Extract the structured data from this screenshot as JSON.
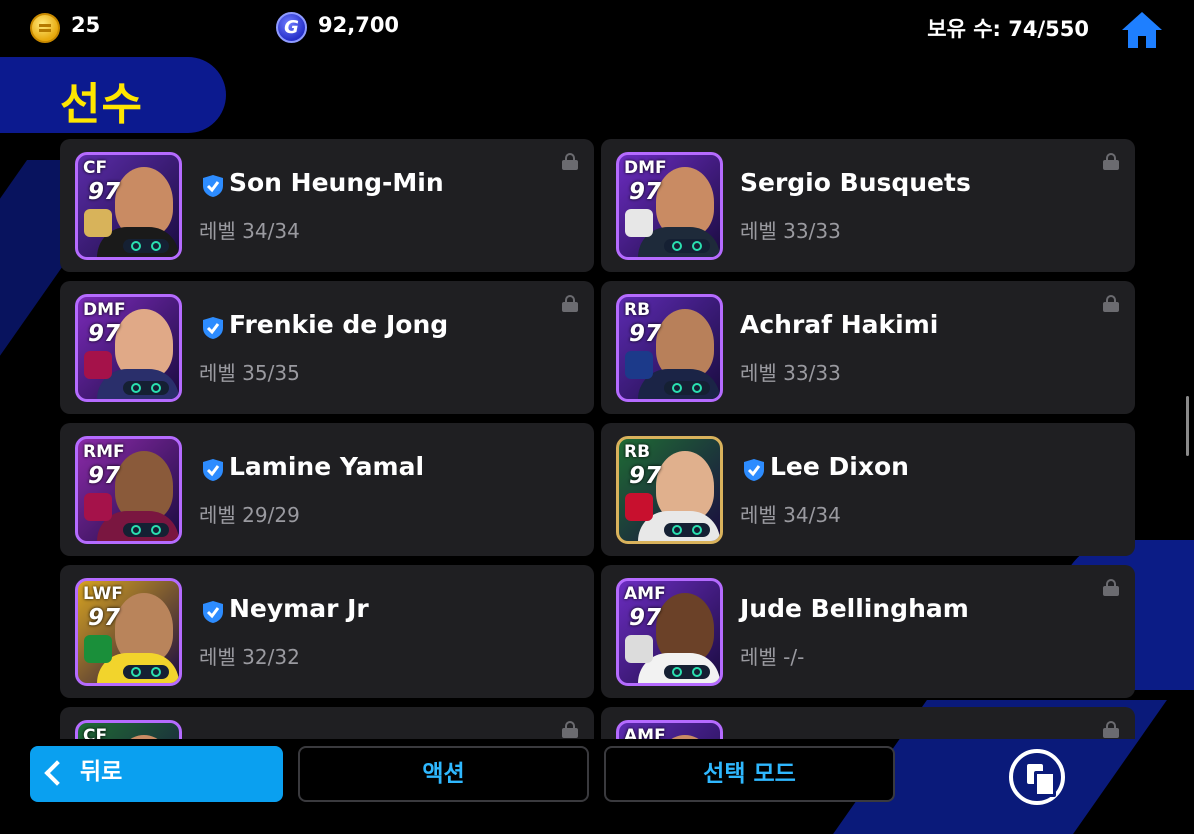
{
  "currency": {
    "coins": "25",
    "gp": "92,700",
    "gp_symbol": "G"
  },
  "owned": "보유 수: 74/550",
  "title": "선수",
  "players": [
    {
      "position": "CF",
      "rating": "97",
      "name": "Son Heung-Min",
      "level": "레벨 34/34",
      "verified": true,
      "locked": true,
      "colors": {
        "bg": "#5b2ca8",
        "skin": "#c98b63",
        "kit": "#1a1a1a",
        "badge": "#d8b35a"
      }
    },
    {
      "position": "DMF",
      "rating": "97",
      "name": "Sergio Busquets",
      "level": "레벨 33/33",
      "verified": false,
      "locked": true,
      "colors": {
        "bg": "#6b2cc0",
        "skin": "#c98b63",
        "kit": "#1e2a3a",
        "badge": "#e7e7e7"
      }
    },
    {
      "position": "DMF",
      "rating": "97",
      "name": "Frenkie de Jong",
      "level": "레벨 35/35",
      "verified": true,
      "locked": true,
      "colors": {
        "bg": "#7a2ab8",
        "skin": "#e0a987",
        "kit": "#2a2f6b",
        "badge": "#a5124a"
      }
    },
    {
      "position": "RB",
      "rating": "97",
      "name": "Achraf Hakimi",
      "level": "레벨 33/33",
      "verified": false,
      "locked": true,
      "colors": {
        "bg": "#5c2ab0",
        "skin": "#b8805a",
        "kit": "#1b2446",
        "badge": "#1c3a8a"
      }
    },
    {
      "position": "RMF",
      "rating": "97",
      "name": "Lamine Yamal",
      "level": "레벨 29/29",
      "verified": true,
      "locked": false,
      "colors": {
        "bg": "#8a2aa8",
        "skin": "#8a5a3a",
        "kit": "#7a1640",
        "badge": "#a5124a"
      }
    },
    {
      "position": "RB",
      "rating": "97",
      "name": "Lee Dixon",
      "level": "레벨 34/34",
      "verified": true,
      "locked": false,
      "colors": {
        "bg": "#1f6b34",
        "skin": "#e0b08d",
        "kit": "#e8e8e8",
        "badge": "#c8102e"
      }
    },
    {
      "position": "LWF",
      "rating": "97",
      "name": "Neymar Jr",
      "level": "레벨 32/32",
      "verified": true,
      "locked": false,
      "colors": {
        "bg": "#d7a321",
        "skin": "#b9845b",
        "kit": "#f2d42c",
        "badge": "#1a8f3a"
      }
    },
    {
      "position": "AMF",
      "rating": "97",
      "name": "Jude Bellingham",
      "level": "레벨 -/-",
      "verified": false,
      "locked": true,
      "colors": {
        "bg": "#6b2cc0",
        "skin": "#6b4128",
        "kit": "#f2f2f2",
        "badge": "#dcdcdc"
      }
    },
    {
      "position": "CF",
      "rating": "",
      "name": "",
      "level": "",
      "verified": false,
      "locked": true,
      "colors": {
        "bg": "#1f6b34",
        "skin": "#c98b63",
        "kit": "#1a1a1a",
        "badge": "#ffffff"
      }
    },
    {
      "position": "AMF",
      "rating": "",
      "name": "",
      "level": "",
      "verified": false,
      "locked": true,
      "colors": {
        "bg": "#5c2ab0",
        "skin": "#c98b63",
        "kit": "#1a1a1a",
        "badge": "#ffffff"
      }
    }
  ],
  "buttons": {
    "back": "뒤로",
    "action": "액션",
    "select_mode": "선택 모드"
  },
  "theme": {
    "accent": "#2fb8ff",
    "title_color": "#ffe600",
    "verify_color": "#2d8cff"
  }
}
